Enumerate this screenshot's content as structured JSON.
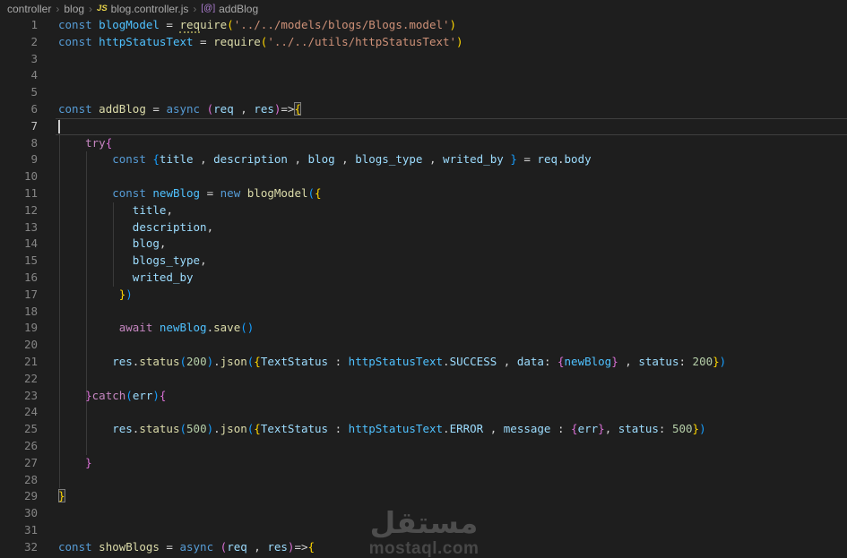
{
  "breadcrumb": {
    "folder": "controller",
    "subfolder": "blog",
    "file": "blog.controller.js",
    "symbol": "addBlog",
    "separator": "›",
    "js_badge": "JS",
    "method_icon": "[@]"
  },
  "editor": {
    "active_line": 7,
    "indent_guides": [
      {
        "x": 65.5,
        "from": 7,
        "to": 28
      },
      {
        "x": 95.5,
        "from": 9,
        "to": 26
      },
      {
        "x": 125.5,
        "from": 12,
        "to": 16
      }
    ],
    "lines": [
      {
        "n": 1,
        "t": [
          [
            "k",
            "const"
          ],
          [
            "p",
            " "
          ],
          [
            "C",
            "blogModel"
          ],
          [
            "p",
            " = "
          ],
          [
            "f",
            "req",
            "hint"
          ],
          [
            "f",
            "uire"
          ],
          [
            "B1",
            "("
          ],
          [
            "s",
            "'../../models/blogs/Blogs.model'"
          ],
          [
            "B1",
            ")"
          ]
        ]
      },
      {
        "n": 2,
        "t": [
          [
            "k",
            "const"
          ],
          [
            "p",
            " "
          ],
          [
            "C",
            "httpStatusText"
          ],
          [
            "p",
            " = "
          ],
          [
            "f",
            "require"
          ],
          [
            "B1",
            "("
          ],
          [
            "s",
            "'../../utils/httpStatusText'"
          ],
          [
            "B1",
            ")"
          ]
        ]
      },
      {
        "n": 3,
        "t": []
      },
      {
        "n": 4,
        "t": []
      },
      {
        "n": 5,
        "t": []
      },
      {
        "n": 6,
        "t": [
          [
            "k",
            "const"
          ],
          [
            "p",
            " "
          ],
          [
            "f",
            "addBlog"
          ],
          [
            "p",
            " = "
          ],
          [
            "k",
            "async"
          ],
          [
            "p",
            " "
          ],
          [
            "B2",
            "("
          ],
          [
            "v",
            "req"
          ],
          [
            "p",
            " , "
          ],
          [
            "v",
            "res"
          ],
          [
            "B2",
            ")"
          ],
          [
            "p",
            "=>"
          ],
          [
            "B1",
            "{",
            "boxed"
          ]
        ]
      },
      {
        "n": 7,
        "t": [],
        "active": true
      },
      {
        "n": 8,
        "t": [
          [
            "p",
            "    "
          ],
          [
            "c",
            "try"
          ],
          [
            "B2",
            "{"
          ]
        ]
      },
      {
        "n": 9,
        "t": [
          [
            "p",
            "        "
          ],
          [
            "k",
            "const"
          ],
          [
            "p",
            " "
          ],
          [
            "B3",
            "{"
          ],
          [
            "v",
            "title"
          ],
          [
            "p",
            " , "
          ],
          [
            "v",
            "description"
          ],
          [
            "p",
            " , "
          ],
          [
            "v",
            "blog"
          ],
          [
            "p",
            " , "
          ],
          [
            "v",
            "blogs_type"
          ],
          [
            "p",
            " , "
          ],
          [
            "v",
            "writed_by"
          ],
          [
            "p",
            " "
          ],
          [
            "B3",
            "}"
          ],
          [
            "p",
            " = "
          ],
          [
            "v",
            "req"
          ],
          [
            "p",
            "."
          ],
          [
            "v",
            "body"
          ]
        ]
      },
      {
        "n": 10,
        "t": []
      },
      {
        "n": 11,
        "t": [
          [
            "p",
            "        "
          ],
          [
            "k",
            "const"
          ],
          [
            "p",
            " "
          ],
          [
            "C",
            "newBlog"
          ],
          [
            "p",
            " = "
          ],
          [
            "k",
            "new"
          ],
          [
            "p",
            " "
          ],
          [
            "f",
            "blogModel"
          ],
          [
            "B3",
            "("
          ],
          [
            "B1",
            "{"
          ]
        ]
      },
      {
        "n": 12,
        "t": [
          [
            "p",
            "           "
          ],
          [
            "v",
            "title"
          ],
          [
            "p",
            ","
          ]
        ]
      },
      {
        "n": 13,
        "t": [
          [
            "p",
            "           "
          ],
          [
            "v",
            "description"
          ],
          [
            "p",
            ","
          ]
        ]
      },
      {
        "n": 14,
        "t": [
          [
            "p",
            "           "
          ],
          [
            "v",
            "blog"
          ],
          [
            "p",
            ","
          ]
        ]
      },
      {
        "n": 15,
        "t": [
          [
            "p",
            "           "
          ],
          [
            "v",
            "blogs_type"
          ],
          [
            "p",
            ","
          ]
        ]
      },
      {
        "n": 16,
        "t": [
          [
            "p",
            "           "
          ],
          [
            "v",
            "writed_by"
          ]
        ]
      },
      {
        "n": 17,
        "t": [
          [
            "p",
            "         "
          ],
          [
            "B1",
            "}"
          ],
          [
            "B3",
            ")"
          ]
        ]
      },
      {
        "n": 18,
        "t": []
      },
      {
        "n": 19,
        "t": [
          [
            "p",
            "         "
          ],
          [
            "c",
            "await"
          ],
          [
            "p",
            " "
          ],
          [
            "C",
            "newBlog"
          ],
          [
            "p",
            "."
          ],
          [
            "f",
            "save"
          ],
          [
            "B3",
            "("
          ],
          [
            "B3",
            ")"
          ]
        ]
      },
      {
        "n": 20,
        "t": []
      },
      {
        "n": 21,
        "t": [
          [
            "p",
            "        "
          ],
          [
            "v",
            "res"
          ],
          [
            "p",
            "."
          ],
          [
            "f",
            "status"
          ],
          [
            "B3",
            "("
          ],
          [
            "n",
            "200"
          ],
          [
            "B3",
            ")"
          ],
          [
            "p",
            "."
          ],
          [
            "f",
            "json"
          ],
          [
            "B3",
            "("
          ],
          [
            "B1",
            "{"
          ],
          [
            "v",
            "TextStatus"
          ],
          [
            "p",
            " : "
          ],
          [
            "C",
            "httpStatusText"
          ],
          [
            "p",
            "."
          ],
          [
            "v",
            "SUCCESS"
          ],
          [
            "p",
            " , "
          ],
          [
            "v",
            "data"
          ],
          [
            "p",
            ": "
          ],
          [
            "B2",
            "{"
          ],
          [
            "C",
            "newBlog"
          ],
          [
            "B2",
            "}"
          ],
          [
            "p",
            " , "
          ],
          [
            "v",
            "status"
          ],
          [
            "p",
            ": "
          ],
          [
            "n",
            "200"
          ],
          [
            "B1",
            "}"
          ],
          [
            "B3",
            ")"
          ]
        ]
      },
      {
        "n": 22,
        "t": []
      },
      {
        "n": 23,
        "t": [
          [
            "p",
            "    "
          ],
          [
            "B2",
            "}"
          ],
          [
            "c",
            "catch"
          ],
          [
            "B3",
            "("
          ],
          [
            "v",
            "err"
          ],
          [
            "B3",
            ")"
          ],
          [
            "B2",
            "{"
          ]
        ]
      },
      {
        "n": 24,
        "t": []
      },
      {
        "n": 25,
        "t": [
          [
            "p",
            "        "
          ],
          [
            "v",
            "res"
          ],
          [
            "p",
            "."
          ],
          [
            "f",
            "status"
          ],
          [
            "B3",
            "("
          ],
          [
            "n",
            "500"
          ],
          [
            "B3",
            ")"
          ],
          [
            "p",
            "."
          ],
          [
            "f",
            "json"
          ],
          [
            "B3",
            "("
          ],
          [
            "B1",
            "{"
          ],
          [
            "v",
            "TextStatus"
          ],
          [
            "p",
            " : "
          ],
          [
            "C",
            "httpStatusText"
          ],
          [
            "p",
            "."
          ],
          [
            "v",
            "ERROR"
          ],
          [
            "p",
            " , "
          ],
          [
            "v",
            "message"
          ],
          [
            "p",
            " : "
          ],
          [
            "B2",
            "{"
          ],
          [
            "v",
            "err"
          ],
          [
            "B2",
            "}"
          ],
          [
            "p",
            ", "
          ],
          [
            "v",
            "status"
          ],
          [
            "p",
            ": "
          ],
          [
            "n",
            "500"
          ],
          [
            "B1",
            "}"
          ],
          [
            "B3",
            ")"
          ]
        ]
      },
      {
        "n": 26,
        "t": []
      },
      {
        "n": 27,
        "t": [
          [
            "p",
            "    "
          ],
          [
            "B2",
            "}"
          ]
        ]
      },
      {
        "n": 28,
        "t": []
      },
      {
        "n": 29,
        "t": [
          [
            "B1",
            "}",
            "boxed"
          ]
        ]
      },
      {
        "n": 30,
        "t": []
      },
      {
        "n": 31,
        "t": []
      },
      {
        "n": 32,
        "t": [
          [
            "k",
            "const"
          ],
          [
            "p",
            " "
          ],
          [
            "f",
            "showBlogs"
          ],
          [
            "p",
            " = "
          ],
          [
            "k",
            "async"
          ],
          [
            "p",
            " "
          ],
          [
            "B2",
            "("
          ],
          [
            "v",
            "req"
          ],
          [
            "p",
            " , "
          ],
          [
            "v",
            "res"
          ],
          [
            "B2",
            ")"
          ],
          [
            "p",
            "=>"
          ],
          [
            "B1",
            "{"
          ]
        ]
      }
    ]
  },
  "watermark": {
    "arabic": "مستقل",
    "domain": "mostaql.com"
  },
  "colors": {
    "background": "#1e1e1e",
    "keyword": "#569cd6",
    "control_keyword": "#c586c0",
    "function": "#dcdcaa",
    "const_variable": "#4fc1ff",
    "variable": "#9cdcfe",
    "string": "#ce9178",
    "number": "#b5cea8",
    "plain": "#d4d4d4",
    "bracket_gold": "#ffd700",
    "bracket_pink": "#da70d6",
    "bracket_blue": "#179fff",
    "line_number": "#858585",
    "active_line_number": "#c6c6c6",
    "breadcrumb_text": "#a9a9a9",
    "js_badge": "#e8d44a",
    "method_icon": "#b180d7",
    "watermark": "#4d4d4d"
  }
}
